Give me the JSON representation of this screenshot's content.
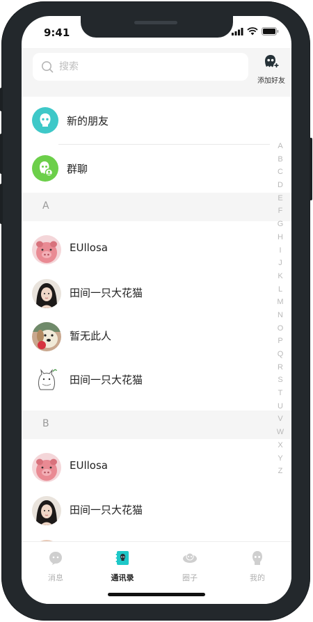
{
  "status": {
    "time": "9:41"
  },
  "header": {
    "search_placeholder": "搜索",
    "add_friend_label": "添加好友"
  },
  "functions": [
    {
      "label": "新的朋友",
      "icon": "new-friend-icon",
      "color": "#3ec8c8"
    },
    {
      "label": "群聊",
      "icon": "group-chat-icon",
      "color": "#6ccf4a"
    }
  ],
  "sections": [
    {
      "letter": "A",
      "contacts": [
        {
          "name": "EUllosa",
          "avatar": "pig-avatar"
        },
        {
          "name": "田间一只大花猫",
          "avatar": "girl-avatar"
        },
        {
          "name": "暂无此人",
          "avatar": "dog-avatar"
        },
        {
          "name": "田间一只大花猫",
          "avatar": "totoro-avatar"
        }
      ]
    },
    {
      "letter": "B",
      "contacts": [
        {
          "name": "EUllosa",
          "avatar": "pig-avatar"
        },
        {
          "name": "田间一只大花猫",
          "avatar": "girl-avatar"
        }
      ]
    }
  ],
  "index_letters": [
    "A",
    "B",
    "C",
    "D",
    "E",
    "F",
    "G",
    "H",
    "I",
    "J",
    "K",
    "L",
    "M",
    "N",
    "O",
    "P",
    "Q",
    "R",
    "S",
    "T",
    "U",
    "V",
    "W",
    "X",
    "Y",
    "Z"
  ],
  "tabs": [
    {
      "label": "消息",
      "icon": "message-icon",
      "active": false
    },
    {
      "label": "通讯录",
      "icon": "contacts-icon",
      "active": true
    },
    {
      "label": "圈子",
      "icon": "circle-icon",
      "active": false
    },
    {
      "label": "我的",
      "icon": "profile-icon",
      "active": false
    }
  ],
  "colors": {
    "accent": "#1ec8c8",
    "section_bg": "#f5f5f5"
  }
}
